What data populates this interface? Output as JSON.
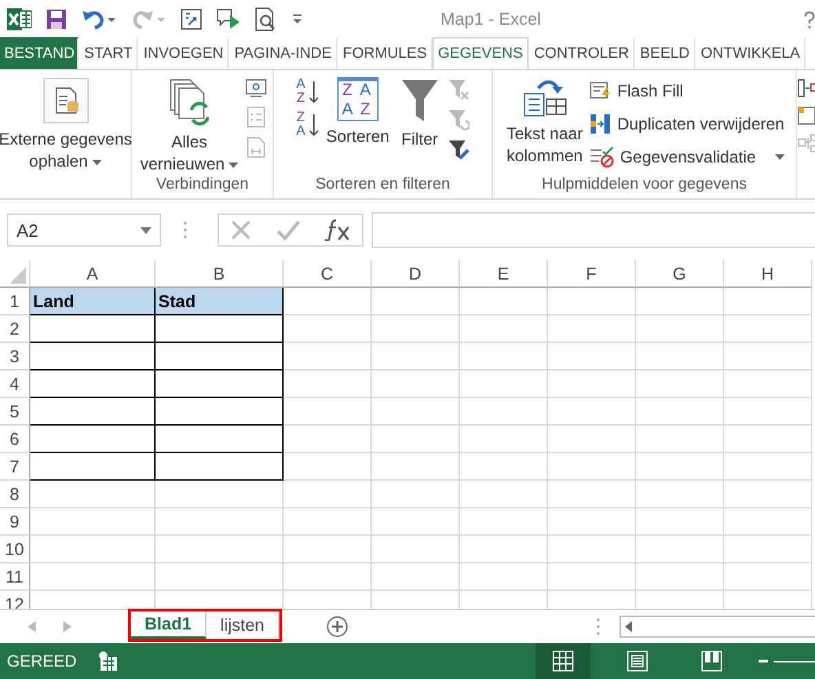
{
  "window": {
    "title": "Map1 - Excel"
  },
  "ribbon_tabs": [
    {
      "label": "BESTAND",
      "kind": "file",
      "selected": false
    },
    {
      "label": "START",
      "kind": "tab",
      "selected": false
    },
    {
      "label": "INVOEGEN",
      "kind": "tab",
      "selected": false
    },
    {
      "label": "PAGINA-INDE",
      "kind": "tab",
      "selected": false
    },
    {
      "label": "FORMULES",
      "kind": "tab",
      "selected": false
    },
    {
      "label": "GEGEVENS",
      "kind": "tab",
      "selected": true
    },
    {
      "label": "CONTROLER",
      "kind": "tab",
      "selected": false
    },
    {
      "label": "BEELD",
      "kind": "tab",
      "selected": false
    },
    {
      "label": "ONTWIKKELA",
      "kind": "tab",
      "selected": false
    }
  ],
  "ribbon": {
    "external": {
      "label_lines": [
        "Externe gegevens",
        "ophalen"
      ]
    },
    "connections": {
      "refresh_lines": [
        "Alles",
        "vernieuwen"
      ],
      "group_label": "Verbindingen"
    },
    "sort_filter": {
      "ascending_letters": [
        "A",
        "Z"
      ],
      "descending_letters": [
        "Z",
        "A"
      ],
      "sort_letters": [
        "Z",
        "A",
        "A",
        "Z"
      ],
      "sort": "Sorteren",
      "filter": "Filter",
      "group_label": "Sorteren en filteren"
    },
    "data_tools": {
      "text_to_columns_lines": [
        "Tekst naar",
        "kolommen"
      ],
      "flash_fill": "Flash Fill",
      "remove_duplicates": "Duplicaten verwijderen",
      "validation": "Gegevensvalidatie",
      "group_label": "Hulpmiddelen voor gegevens"
    }
  },
  "formula_bar": {
    "name_box": "A2"
  },
  "sheet": {
    "columns": [
      "A",
      "B",
      "C",
      "D",
      "E",
      "F",
      "G",
      "H"
    ],
    "rows": [
      {
        "number": "1",
        "kind": "header",
        "bordered": true,
        "cells": [
          "Land",
          "Stad"
        ]
      },
      {
        "number": "2",
        "kind": "data",
        "bordered": true
      },
      {
        "number": "3",
        "kind": "data",
        "bordered": true
      },
      {
        "number": "4",
        "kind": "data",
        "bordered": true
      },
      {
        "number": "5",
        "kind": "data",
        "bordered": true
      },
      {
        "number": "6",
        "kind": "data",
        "bordered": true
      },
      {
        "number": "7",
        "kind": "data",
        "bordered": true
      },
      {
        "number": "8",
        "kind": "data",
        "bordered": false
      },
      {
        "number": "9",
        "kind": "data",
        "bordered": false
      },
      {
        "number": "10",
        "kind": "data",
        "bordered": false
      },
      {
        "number": "11",
        "kind": "data",
        "bordered": false
      },
      {
        "number": "12",
        "kind": "data",
        "bordered": false
      }
    ]
  },
  "sheet_tabs": [
    {
      "label": "Blad1",
      "selected": true
    },
    {
      "label": "lijsten",
      "selected": false
    }
  ],
  "status_bar": {
    "status": "GEREED"
  }
}
